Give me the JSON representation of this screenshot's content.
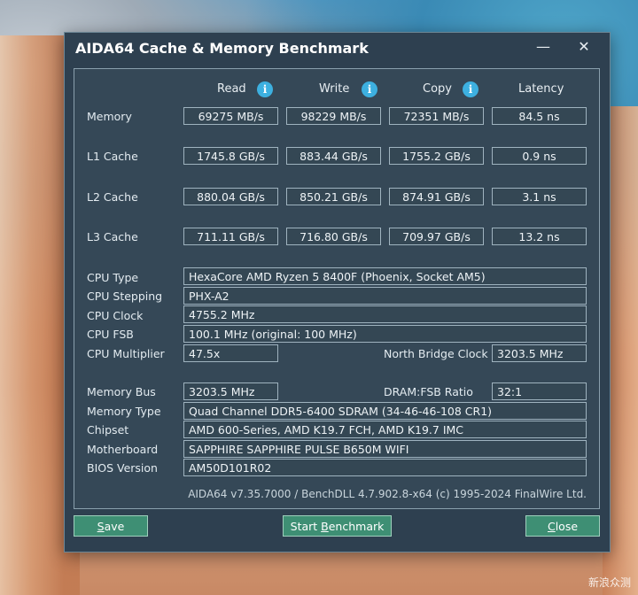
{
  "window": {
    "title": "AIDA64 Cache & Memory Benchmark",
    "minimize": "—",
    "close": "✕"
  },
  "headers": {
    "read": "Read",
    "write": "Write",
    "copy": "Copy",
    "latency": "Latency",
    "info_icon": "i"
  },
  "bench_rows": [
    {
      "label": "Memory",
      "read": "69275 MB/s",
      "write": "98229 MB/s",
      "copy": "72351 MB/s",
      "latency": "84.5 ns"
    },
    {
      "label": "L1 Cache",
      "read": "1745.8 GB/s",
      "write": "883.44 GB/s",
      "copy": "1755.2 GB/s",
      "latency": "0.9 ns"
    },
    {
      "label": "L2 Cache",
      "read": "880.04 GB/s",
      "write": "850.21 GB/s",
      "copy": "874.91 GB/s",
      "latency": "3.1 ns"
    },
    {
      "label": "L3 Cache",
      "read": "711.11 GB/s",
      "write": "716.80 GB/s",
      "copy": "709.97 GB/s",
      "latency": "13.2 ns"
    }
  ],
  "cpu": {
    "type_label": "CPU Type",
    "type_value": "HexaCore AMD Ryzen 5 8400F  (Phoenix, Socket AM5)",
    "stepping_label": "CPU Stepping",
    "stepping_value": "PHX-A2",
    "clock_label": "CPU Clock",
    "clock_value": "4755.2 MHz",
    "fsb_label": "CPU FSB",
    "fsb_value": "100.1 MHz  (original: 100 MHz)",
    "multiplier_label": "CPU Multiplier",
    "multiplier_value": "47.5x",
    "nb_clock_label": "North Bridge Clock",
    "nb_clock_value": "3203.5 MHz"
  },
  "memory": {
    "bus_label": "Memory Bus",
    "bus_value": "3203.5 MHz",
    "ratio_label": "DRAM:FSB Ratio",
    "ratio_value": "32:1",
    "type_label": "Memory Type",
    "type_value": "Quad Channel DDR5-6400 SDRAM  (34-46-46-108 CR1)",
    "chipset_label": "Chipset",
    "chipset_value": "AMD 600-Series, AMD K19.7 FCH, AMD K19.7 IMC",
    "mobo_label": "Motherboard",
    "mobo_value": "SAPPHIRE SAPPHIRE PULSE B650M WIFI",
    "bios_label": "BIOS Version",
    "bios_value": "AM50D101R02"
  },
  "footer": "AIDA64 v7.35.7000 / BenchDLL 4.7.902.8-x64  (c) 1995-2024 FinalWire Ltd.",
  "buttons": {
    "save_u": "S",
    "save_rest": "ave",
    "start_pre": "Start ",
    "start_u": "B",
    "start_rest": "enchmark",
    "close_u": "C",
    "close_rest": "lose"
  },
  "watermark": "新浪众测"
}
